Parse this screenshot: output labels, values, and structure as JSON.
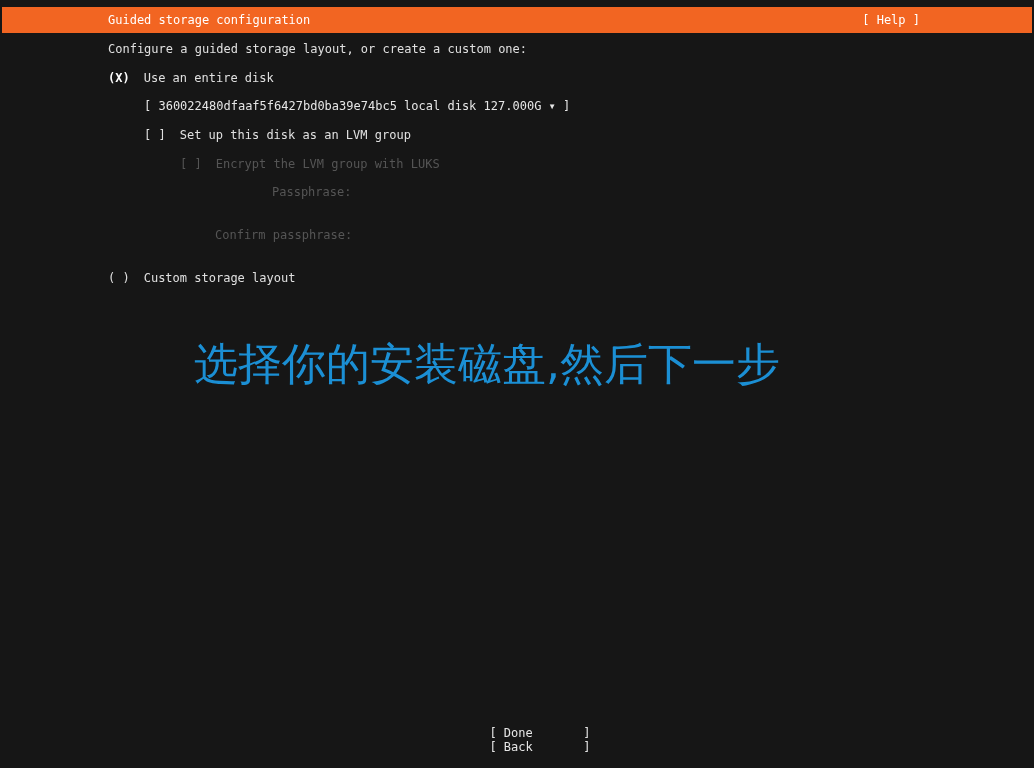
{
  "header": {
    "title": "Guided storage configuration",
    "help": "[ Help ]"
  },
  "intro": "Configure a guided storage layout, or create a custom one:",
  "options": [
    {
      "kind": "disk",
      "marker": "(X)",
      "label": "Use an entire disk",
      "selected": true,
      "disk_select": "[ 360022480dfaaf5f6427bd0ba39e74bc5 local disk 127.000G ▾ ]",
      "lvm": {
        "marker": "[ ]",
        "label": "Set up this disk as an LVM group",
        "checked": false
      },
      "encrypt": {
        "marker": "[ ]",
        "label": "Encrypt the LVM group with LUKS",
        "checked": false,
        "disabled": true
      },
      "fields": [
        {
          "label": "Passphrase:",
          "disabled": true
        },
        {
          "label": "Confirm passphrase:",
          "disabled": true
        }
      ]
    },
    {
      "kind": "custom",
      "marker": "( )",
      "label": "Custom storage layout",
      "selected": false
    }
  ],
  "caption": "选择你的安装磁盘,然后下一步",
  "buttons": [
    {
      "label": "[ Done       ]"
    },
    {
      "label": "[ Back       ]"
    }
  ]
}
